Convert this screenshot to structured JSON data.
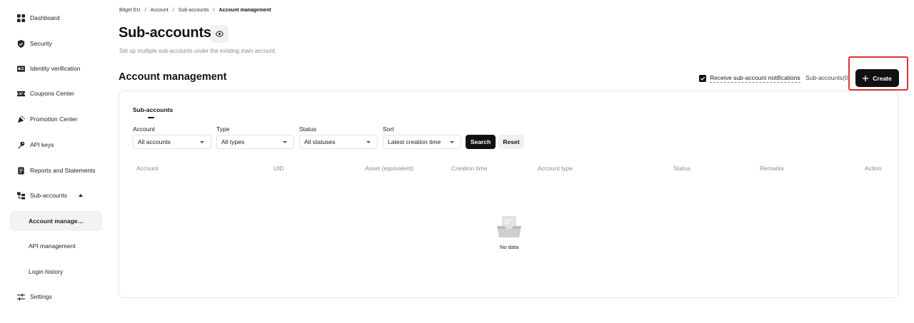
{
  "sidebar": {
    "items": [
      {
        "label": "Dashboard",
        "icon": "grid-icon"
      },
      {
        "label": "Security",
        "icon": "shield-icon"
      },
      {
        "label": "Identity verification",
        "icon": "id-card-icon"
      },
      {
        "label": "Coupons Center",
        "icon": "coupon-icon"
      },
      {
        "label": "Promotion Center",
        "icon": "megaphone-icon"
      },
      {
        "label": "API keys",
        "icon": "key-icon"
      },
      {
        "label": "Reports and Statements",
        "icon": "report-icon"
      },
      {
        "label": "Sub-accounts",
        "icon": "hierarchy-icon"
      },
      {
        "label": "Account manage…"
      },
      {
        "label": "API management"
      },
      {
        "label": "Login history"
      },
      {
        "label": "Settings",
        "icon": "sliders-icon"
      }
    ]
  },
  "breadcrumb": {
    "items": [
      "Bitget EU",
      "Account",
      "Sub-accounts",
      "Account management"
    ],
    "separator": "/"
  },
  "page": {
    "title": "Sub-accounts",
    "subtitle": "Set up multiple sub-accounts under the existing main account.",
    "section_title": "Account management"
  },
  "actions": {
    "notify_label": "Receive sub-account notifications",
    "notify_checked": true,
    "sub_count": "Sub-accounts(0)",
    "create_label": "Create",
    "highlight_color": "#e03232"
  },
  "card": {
    "tab": "Sub-accounts",
    "filters": [
      {
        "label": "Account",
        "value": "All accounts"
      },
      {
        "label": "Type",
        "value": "All types"
      },
      {
        "label": "Status",
        "value": "All statuses"
      },
      {
        "label": "Sort",
        "value": "Latest creation time"
      }
    ],
    "search_label": "Search",
    "reset_label": "Reset",
    "columns": [
      "Account",
      "UID",
      "Asset (equivalent)",
      "Creation time",
      "Account type",
      "Status",
      "Remarks",
      "Action"
    ],
    "empty_text": "No data"
  }
}
